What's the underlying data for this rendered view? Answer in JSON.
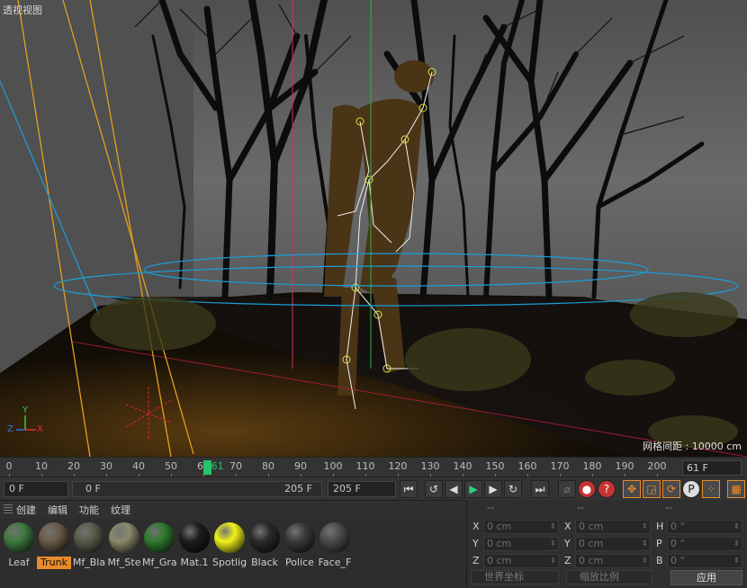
{
  "viewport": {
    "title": "透视视图",
    "grid_spacing": "网格间距 : 10000 cm",
    "axis": {
      "x": "X",
      "y": "Y",
      "z": "Z"
    }
  },
  "timeline": {
    "ticks": [
      "0",
      "10",
      "20",
      "30",
      "40",
      "50",
      "60",
      "70",
      "80",
      "90",
      "100",
      "110",
      "120",
      "130",
      "140",
      "150",
      "160",
      "170",
      "180",
      "190",
      "200"
    ],
    "current_frame_label": "61",
    "current_frame": 61,
    "total_frames": 205,
    "frame_field": "61 F"
  },
  "transport": {
    "start_field": "0 F",
    "range_start": "0 F",
    "range_end": "205 F",
    "end_field": "205 F",
    "buttons": {
      "go_start": "⏮",
      "prev_key": "↺",
      "prev_frame": "◀",
      "play": "▶",
      "next_frame": "▶",
      "next_key": "↻",
      "go_end": "⏭"
    }
  },
  "materials": {
    "menu": [
      "创建",
      "编辑",
      "功能",
      "纹理"
    ],
    "items": [
      {
        "label": "Leaf",
        "color": "#3f7a3f",
        "selected": false
      },
      {
        "label": "Trunk",
        "color": "#6b5a48",
        "selected": true
      },
      {
        "label": "Mf_Bla",
        "color": "#5a5a4a",
        "selected": false
      },
      {
        "label": "Mf_Ste",
        "color": "#8a8a6a",
        "selected": false
      },
      {
        "label": "Mf_Gra",
        "color": "#2f7a2f",
        "selected": false
      },
      {
        "label": "Mat.1",
        "color": "#1c1c1c",
        "selected": false
      },
      {
        "label": "Spotlig",
        "color": "#f2f21a",
        "selected": false
      },
      {
        "label": "Black",
        "color": "#2a2a2a",
        "selected": false
      },
      {
        "label": "Police",
        "color": "#3a3a3a",
        "selected": false
      },
      {
        "label": "Face_F",
        "color": "#4a4a4a",
        "selected": false
      }
    ]
  },
  "coords": {
    "headers": [
      "--",
      "--",
      "--"
    ],
    "rows": [
      {
        "l1": "X",
        "v1": "0 cm",
        "l2": "X",
        "v2": "0 cm",
        "l3": "H",
        "v3": "0 °"
      },
      {
        "l1": "Y",
        "v1": "0 cm",
        "l2": "Y",
        "v2": "0 cm",
        "l3": "P",
        "v3": "0 °"
      },
      {
        "l1": "Z",
        "v1": "0 cm",
        "l2": "Z",
        "v2": "0 cm",
        "l3": "B",
        "v3": "0 °"
      }
    ],
    "mode_world": "世界坐标",
    "mode_scale": "缩放比例",
    "apply": "应用"
  },
  "colors": {
    "accent": "#e98b2a",
    "playhead": "#26c26c",
    "selection": "#e98b2a"
  }
}
